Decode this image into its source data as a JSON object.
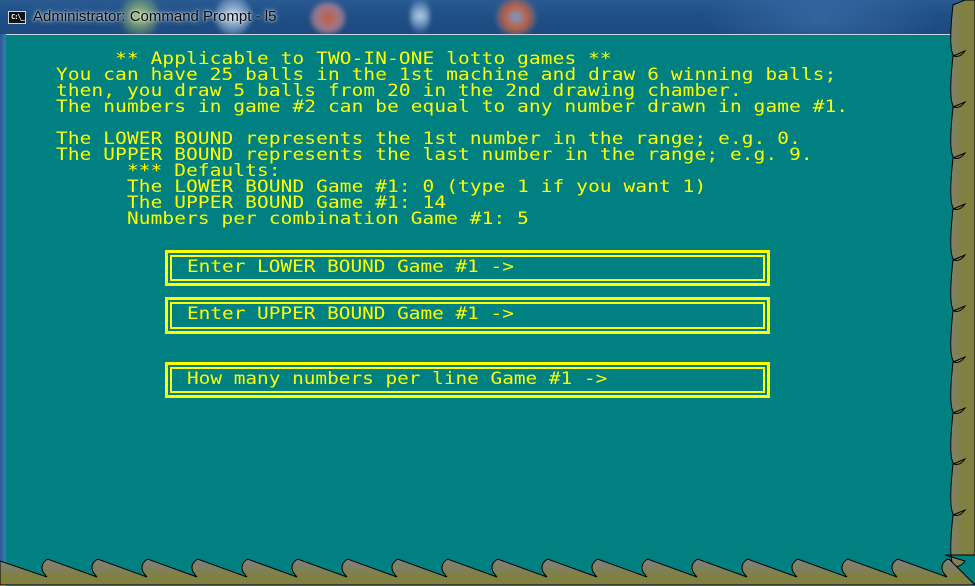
{
  "window": {
    "title": "Administrator: Command Prompt - l5",
    "icon": "cmd-icon",
    "icon_text": "C:\\_"
  },
  "colors": {
    "console_bg": "#008080",
    "console_fg": "#ffff00",
    "titlebar": "#1f4f86",
    "desktop": "#808040"
  },
  "console": {
    "lines": [
      "     ** Applicable to TWO-IN-ONE lotto games **",
      "You can have 25 balls in the 1st machine and draw 6 winning balls;",
      "then, you draw 5 balls from 20 in the 2nd drawing chamber.",
      "The numbers in game #2 can be equal to any number drawn in game #1.",
      "",
      "The LOWER BOUND represents the 1st number in the range; e.g. 0.",
      "The UPPER BOUND represents the last number in the range; e.g. 9.",
      "      *** Defaults:",
      "      The LOWER BOUND Game #1: 0 (type 1 if you want 1)",
      "      The UPPER BOUND Game #1: 14",
      "      Numbers per combination Game #1: 5"
    ]
  },
  "prompts": [
    {
      "label": "Enter LOWER BOUND Game #1 ->",
      "value": ""
    },
    {
      "label": "Enter UPPER BOUND Game #1 ->",
      "value": ""
    },
    {
      "label": "How many numbers per line Game #1 ->",
      "value": ""
    }
  ]
}
